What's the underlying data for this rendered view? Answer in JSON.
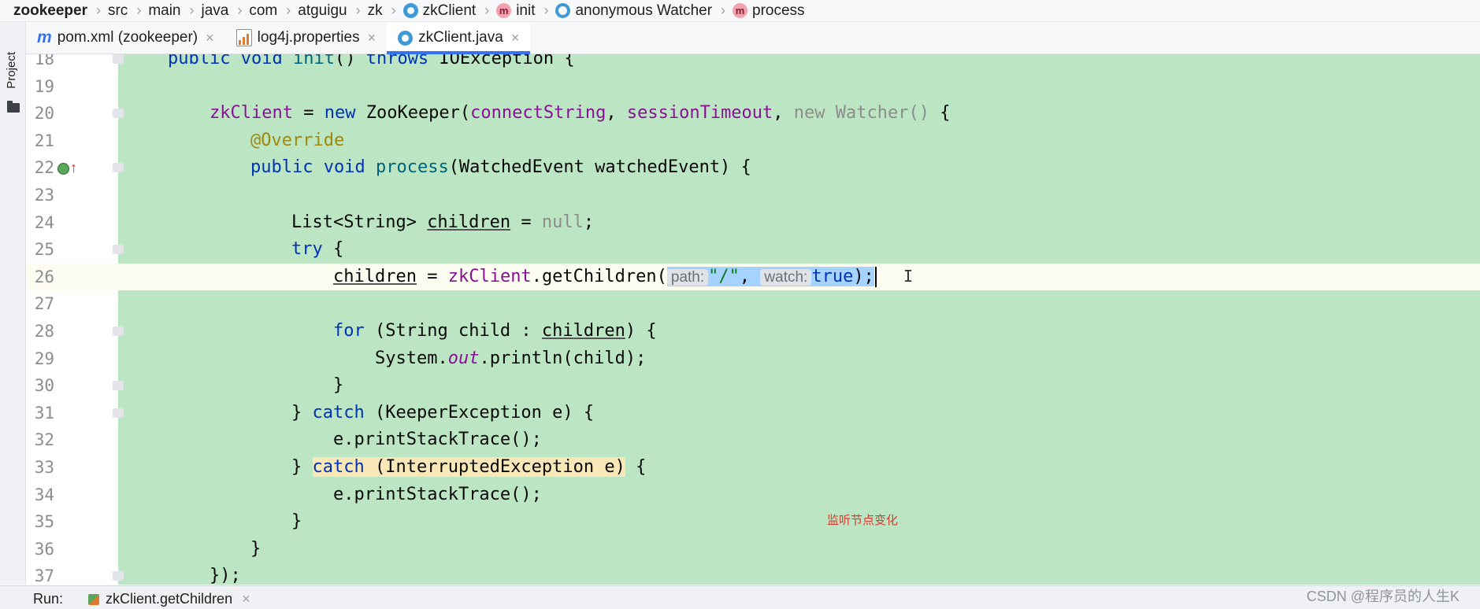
{
  "breadcrumb": {
    "items": [
      {
        "label": "zookeeper",
        "icon": ""
      },
      {
        "label": "src",
        "icon": ""
      },
      {
        "label": "main",
        "icon": ""
      },
      {
        "label": "java",
        "icon": ""
      },
      {
        "label": "com",
        "icon": ""
      },
      {
        "label": "atguigu",
        "icon": ""
      },
      {
        "label": "zk",
        "icon": ""
      },
      {
        "label": "zkClient",
        "icon": "class-icon"
      },
      {
        "label": "init",
        "icon": "method-icon"
      },
      {
        "label": "anonymous Watcher",
        "icon": "anonymous-class-icon"
      },
      {
        "label": "process",
        "icon": "method-icon"
      }
    ],
    "method_glyph": "m"
  },
  "sidebar": {
    "project_label": "Project"
  },
  "tabs": [
    {
      "label": "pom.xml (zookeeper)",
      "icon": "maven-icon",
      "glyph": "m",
      "active": false
    },
    {
      "label": "log4j.properties",
      "icon": "properties-file-icon",
      "active": false
    },
    {
      "label": "zkClient.java",
      "icon": "java-class-icon",
      "active": true
    }
  ],
  "tab_close_glyph": "×",
  "editor": {
    "line_numbers": [
      "18",
      "19",
      "20",
      "21",
      "22",
      "23",
      "24",
      "25",
      "26",
      "27",
      "28",
      "29",
      "30",
      "31",
      "32",
      "33",
      "34",
      "35",
      "36",
      "37"
    ],
    "code": {
      "l18": {
        "kw1": "public",
        "kw2": "void",
        "fn": "init",
        "tail1": "() ",
        "kw3": "throws",
        "tail2": " IOException {"
      },
      "l20": {
        "fld": "zkClient",
        "eq": " = ",
        "kw": "new",
        "cls": " ZooKeeper(",
        "a1": "connectString",
        "c1": ", ",
        "a2": "sessionTimeout",
        "c2": ", ",
        "gray": "new Watcher()",
        "tail": " {"
      },
      "l21": {
        "ann": "@Override"
      },
      "l22": {
        "kw1": "public",
        "kw2": "void",
        "fn": "process",
        "tail": "(WatchedEvent watchedEvent) {"
      },
      "l24": {
        "head": "List<String> ",
        "var": "children",
        "eq": " = ",
        "gray": "null",
        "tail": ";"
      },
      "l25": {
        "kw": "try",
        "tail": " {"
      },
      "l26": {
        "var": "children",
        "eq": " = ",
        "fld": "zkClient",
        "dot": ".",
        "call": "getChildren(",
        "hint1": "path:",
        "str": "\"/\"",
        "comma": ", ",
        "hint2": "watch:",
        "kw": "true",
        "tail": ");"
      },
      "l28": {
        "kw": "for",
        "head": " (String child : ",
        "var": "children",
        "tail": ") {"
      },
      "l29": {
        "head": "System.",
        "stat": "out",
        "tail": ".println(child);"
      },
      "l30": {
        "text": "}"
      },
      "l31": {
        "head": "} ",
        "kw": "catch",
        "tail": " (KeeperException e) {"
      },
      "l32": {
        "text": "e.printStackTrace();"
      },
      "l33": {
        "head": "} ",
        "kw": "catch",
        "hl": " (InterruptedException e)",
        "tail": " {"
      },
      "l34": {
        "text": "e.printStackTrace();"
      },
      "l35": {
        "text": "}"
      },
      "l36": {
        "text": "}"
      },
      "l37": {
        "text": "});"
      }
    },
    "ibeam_glyph": "I",
    "annotation_note": "监听节点变化",
    "override_marker_arrow": "↑"
  },
  "run_panel": {
    "label": "Run:",
    "tab_label": "zkClient.getChildren",
    "close_glyph": "×"
  },
  "watermark": "CSDN @程序员的人生K",
  "colors": {
    "background": "#bce6c3",
    "selection": "#a6d2ff",
    "keyword": "#0033b3",
    "active_tab_underline": "#3574f0"
  }
}
